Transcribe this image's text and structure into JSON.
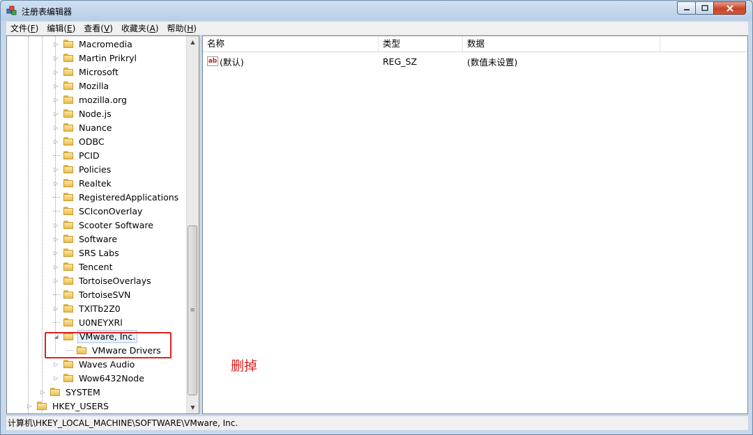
{
  "window": {
    "title": "注册表编辑器",
    "app_icon": "regedit-icon"
  },
  "menu": [
    {
      "label": "文件",
      "accel": "F"
    },
    {
      "label": "编辑",
      "accel": "E"
    },
    {
      "label": "查看",
      "accel": "V"
    },
    {
      "label": "收藏夹",
      "accel": "A"
    },
    {
      "label": "帮助",
      "accel": "H"
    }
  ],
  "tree": {
    "items": [
      {
        "label": "Macromedia",
        "expander": "collapsed"
      },
      {
        "label": "Martin Prikryl",
        "expander": "collapsed"
      },
      {
        "label": "Microsoft",
        "expander": "collapsed"
      },
      {
        "label": "Mozilla",
        "expander": "collapsed"
      },
      {
        "label": "mozilla.org",
        "expander": "collapsed"
      },
      {
        "label": "Node.js",
        "expander": "collapsed"
      },
      {
        "label": "Nuance",
        "expander": "collapsed"
      },
      {
        "label": "ODBC",
        "expander": "collapsed"
      },
      {
        "label": "PCID",
        "expander": "none"
      },
      {
        "label": "Policies",
        "expander": "collapsed"
      },
      {
        "label": "Realtek",
        "expander": "collapsed"
      },
      {
        "label": "RegisteredApplications",
        "expander": "none"
      },
      {
        "label": "SCIconOverlay",
        "expander": "none"
      },
      {
        "label": "Scooter Software",
        "expander": "collapsed"
      },
      {
        "label": "Software",
        "expander": "collapsed"
      },
      {
        "label": "SRS Labs",
        "expander": "collapsed"
      },
      {
        "label": "Tencent",
        "expander": "collapsed"
      },
      {
        "label": "TortoiseOverlays",
        "expander": "collapsed"
      },
      {
        "label": "TortoiseSVN",
        "expander": "none"
      },
      {
        "label": "TXlTb2Z0",
        "expander": "collapsed"
      },
      {
        "label": "U0NEYXRl",
        "expander": "none"
      },
      {
        "label": "VMware, Inc.",
        "expander": "expanded",
        "selected": true
      },
      {
        "label": "VMware Drivers",
        "expander": "none",
        "child": true
      },
      {
        "label": "Waves Audio",
        "expander": "collapsed"
      },
      {
        "label": "Wow6432Node",
        "expander": "collapsed"
      }
    ],
    "system": {
      "label": "SYSTEM"
    },
    "hkey_users": {
      "label": "HKEY_USERS"
    }
  },
  "list": {
    "columns": [
      "名称",
      "类型",
      "数据"
    ],
    "rows": [
      {
        "name": "(默认)",
        "type": "REG_SZ",
        "data": "(数值未设置)",
        "icon": "string-value-icon"
      }
    ]
  },
  "status": {
    "path": "计算机\\HKEY_LOCAL_MACHINE\\SOFTWARE\\VMware, Inc."
  },
  "annotation": {
    "text": "删掉",
    "color": "#e02020"
  }
}
